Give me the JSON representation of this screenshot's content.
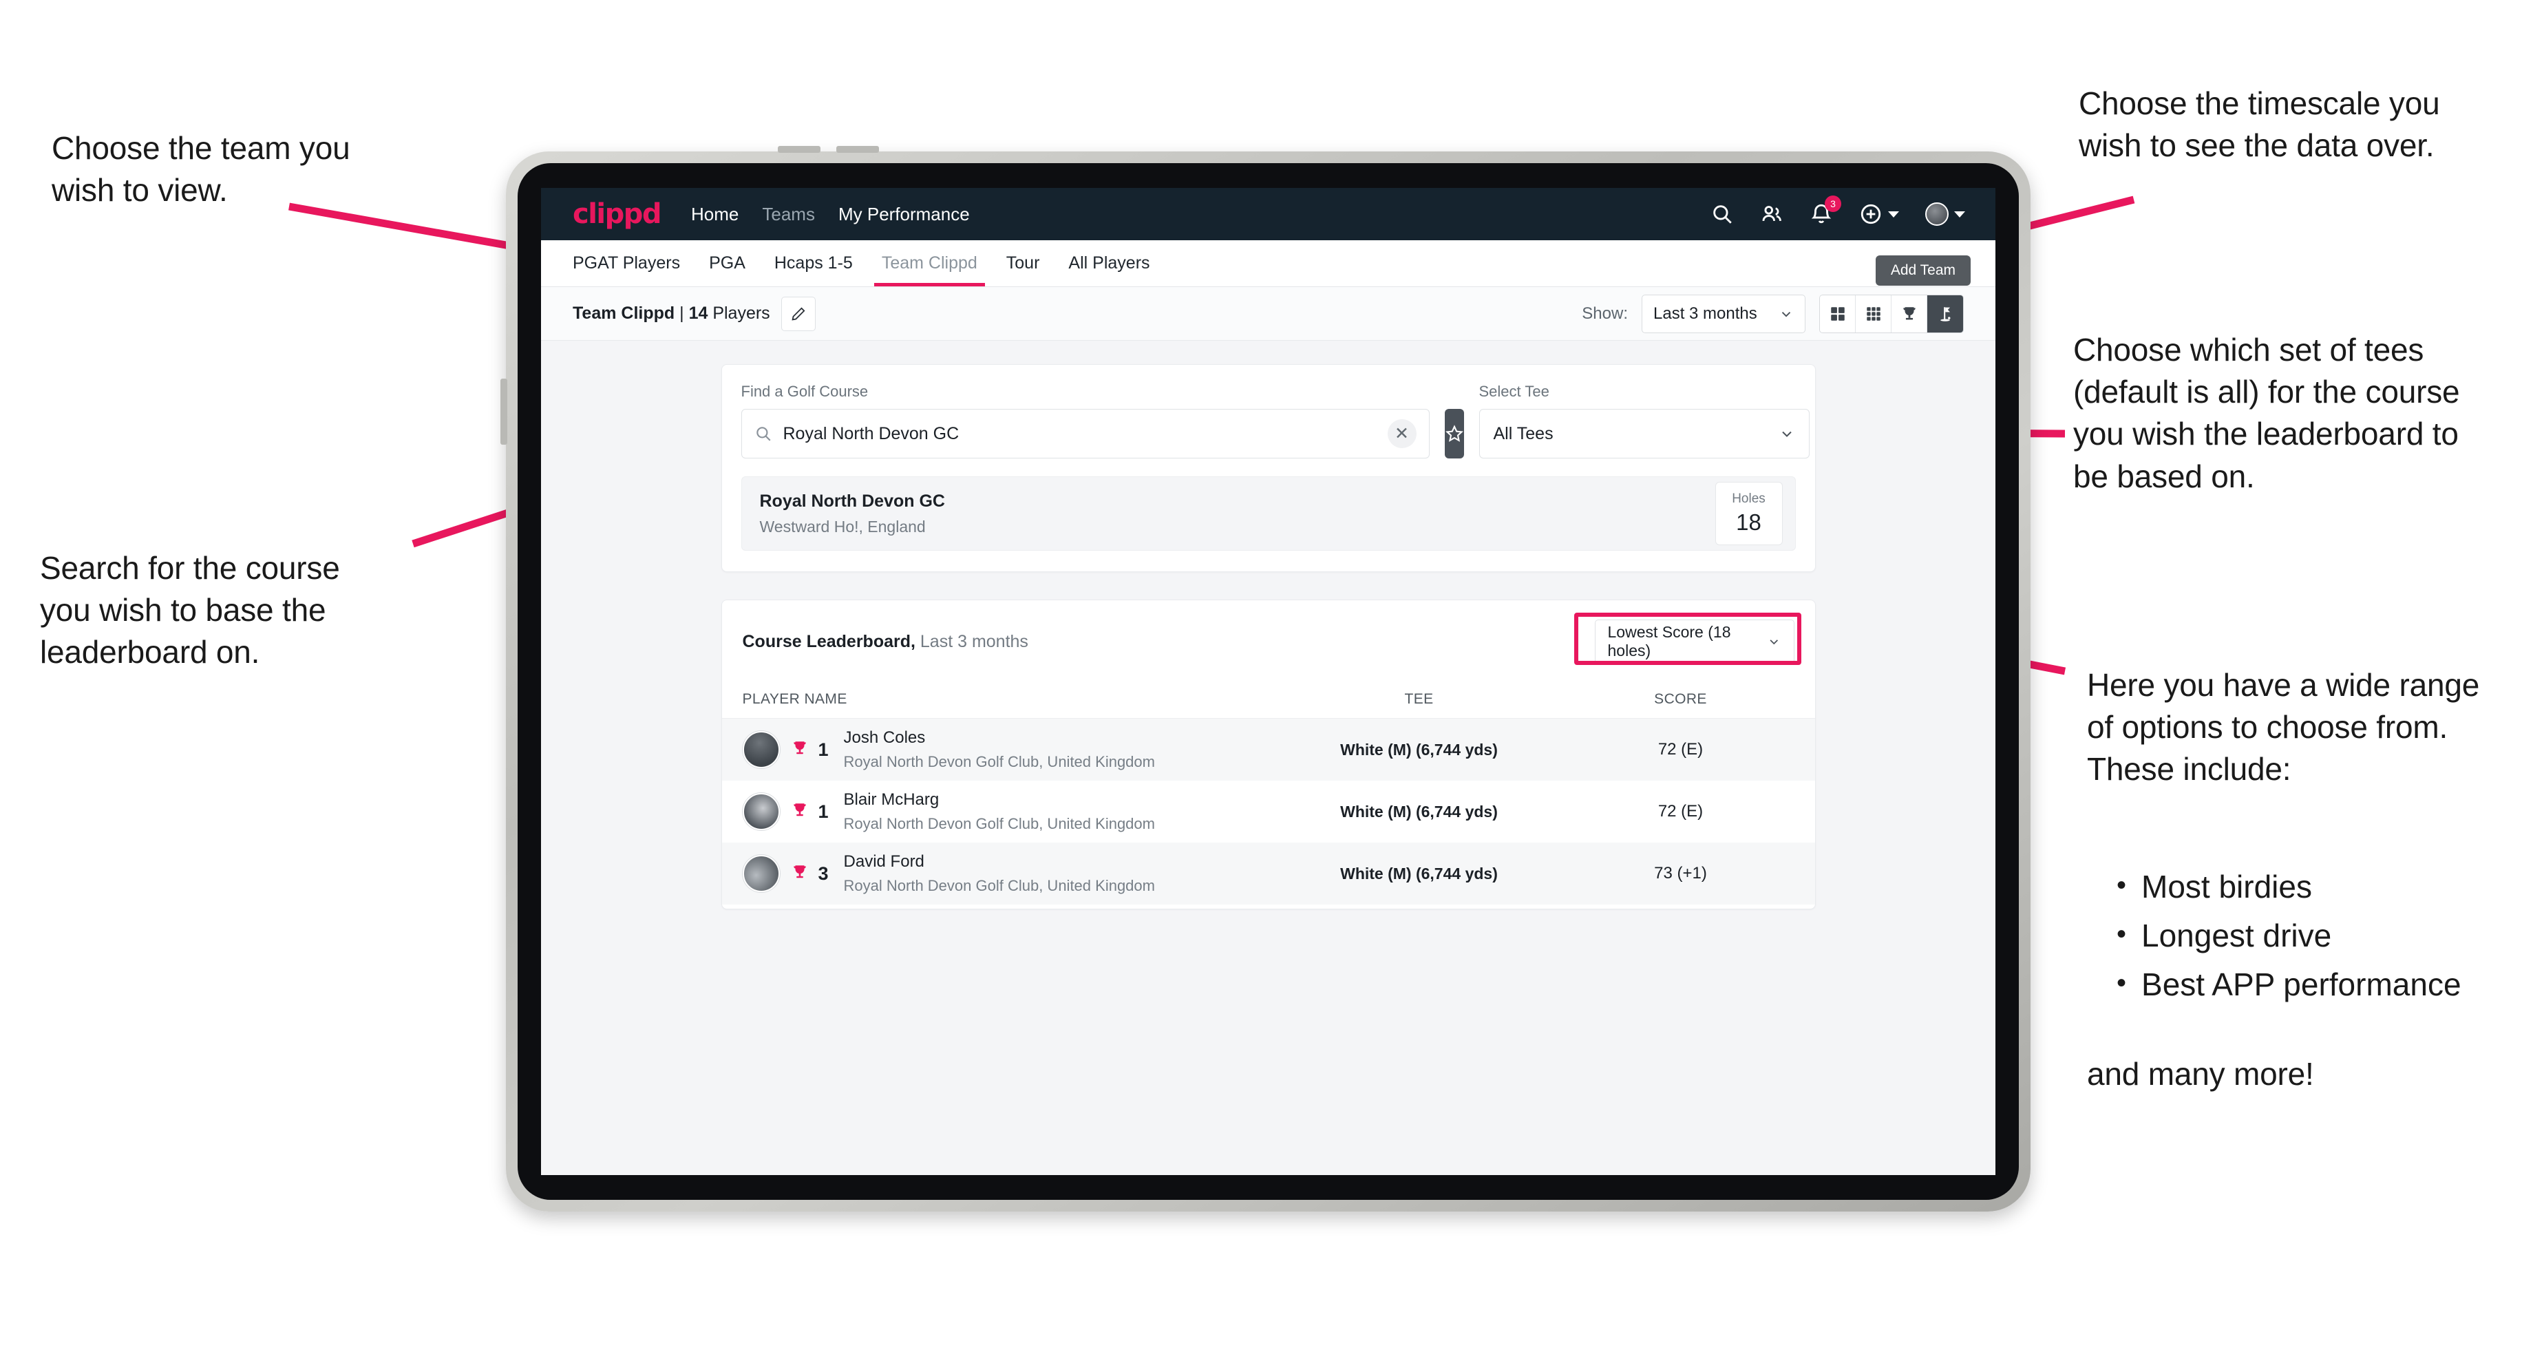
{
  "annotations": {
    "team": "Choose the team you\nwish to view.",
    "search": "Search for the course\nyou wish to base the\nleaderboard on.",
    "timescale": "Choose the timescale you\nwish to see the data over.",
    "tees": "Choose which set of tees\n(default is all) for the course\nyou wish the leaderboard to\nbe based on.",
    "options_intro": "Here you have a wide range\nof options to choose from.\nThese include:",
    "options_list": [
      "Most birdies",
      "Longest drive",
      "Best APP performance"
    ],
    "options_outro": "and many more!"
  },
  "app": {
    "logo": "clippd",
    "nav": [
      {
        "label": "Home",
        "active": true
      },
      {
        "label": "Teams",
        "active": false
      },
      {
        "label": "My Performance",
        "active": true
      }
    ],
    "icons": {
      "search": "search-icon",
      "people": "people-icon",
      "bell": "bell-icon",
      "plus": "plus-circle-icon",
      "avatar": "avatar-icon"
    },
    "notification_count": "3"
  },
  "tabs": {
    "items": [
      {
        "label": "PGAT Players",
        "state": "normal"
      },
      {
        "label": "PGA",
        "state": "normal"
      },
      {
        "label": "Hcaps 1-5",
        "state": "normal"
      },
      {
        "label": "Team Clippd",
        "state": "active"
      },
      {
        "label": "Tour",
        "state": "normal"
      },
      {
        "label": "All Players",
        "state": "normal"
      }
    ],
    "tooltip": "Add Team"
  },
  "toolbar": {
    "team_name": "Team Clippd",
    "separator": " | ",
    "player_count": "14",
    "players_word": " Players",
    "edit_icon": "pencil-icon",
    "show_label": "Show:",
    "timescale_value": "Last 3 months",
    "view_toggles": [
      {
        "icon": "grid-2x2-icon",
        "active": false
      },
      {
        "icon": "grid-3x3-icon",
        "active": false
      },
      {
        "icon": "trophy-icon",
        "active": false
      },
      {
        "icon": "golf-flag-icon",
        "active": true
      }
    ]
  },
  "search_panel": {
    "course_label": "Find a Golf Course",
    "course_value": "Royal North Devon GC",
    "course_placeholder": "Find a Golf Course",
    "clear_icon": "close-icon",
    "favourite_icon": "star-icon",
    "tee_label": "Select Tee",
    "tee_value": "All Tees"
  },
  "course_result": {
    "name": "Royal North Devon GC",
    "location": "Westward Ho!, England",
    "holes_label": "Holes",
    "holes_value": "18"
  },
  "leaderboard": {
    "title": "Course Leaderboard,",
    "subtitle": " Last 3 months",
    "metric": "Lowest Score (18 holes)",
    "columns": [
      "PLAYER NAME",
      "TEE",
      "SCORE"
    ],
    "rows": [
      {
        "rank": "1",
        "name": "Josh Coles",
        "club": "Royal North Devon Golf Club, United Kingdom",
        "tee": "White (M) (6,744 yds)",
        "score": "72 (E)",
        "trophy": "trophy-icon"
      },
      {
        "rank": "1",
        "name": "Blair McHarg",
        "club": "Royal North Devon Golf Club, United Kingdom",
        "tee": "White (M) (6,744 yds)",
        "score": "72 (E)",
        "trophy": "trophy-icon"
      },
      {
        "rank": "3",
        "name": "David Ford",
        "club": "Royal North Devon Golf Club, United Kingdom",
        "tee": "White (M) (6,744 yds)",
        "score": "73 (+1)",
        "trophy": "trophy-icon"
      }
    ]
  },
  "colors": {
    "accent": "#e8175d",
    "appbar": "#15232e",
    "screen_bg": "#f4f5f7",
    "dark_control": "#434a51"
  }
}
